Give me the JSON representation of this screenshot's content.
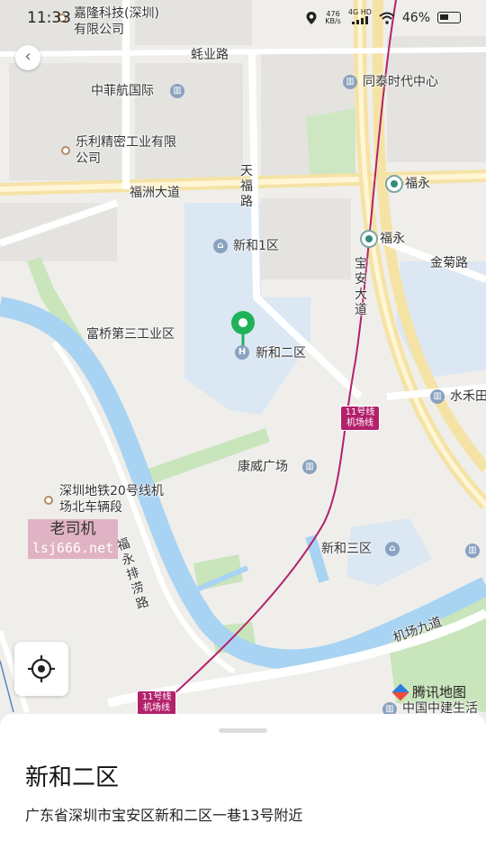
{
  "status_bar": {
    "time": "11:33",
    "net_speed": "476",
    "net_unit": "KB/s",
    "network": "4G HD",
    "battery": "46%"
  },
  "map": {
    "labels": {
      "jialong": "嘉隆科技(深圳)有限公司",
      "haoye_road": "蚝业路",
      "zhongfei": "中菲航国际",
      "tongtai": "同泰时代中心",
      "leli": "乐利精密工业有限公司",
      "fuzhou_ave": "福洲大道",
      "tianfu_road": "天福路",
      "fuyong_a": "福永",
      "fuyong_b": "福永",
      "xinhe1": "新和1区",
      "jinju_road": "金菊路",
      "baoan_ave": "宝安大道",
      "fuqiao": "富桥第三工业区",
      "xinhe2": "新和二区",
      "shuihe": "水禾田",
      "kangwei": "康威广场",
      "metro_depot": "深圳地铁20号线机场北车辆段",
      "fuyong_drain": "福永排涝路",
      "xinhe3": "新和三区",
      "airport_9": "机场九道",
      "cscec": "中国中建生活"
    },
    "line11_badge": "11号线机场线",
    "brand": "腾讯地图",
    "watermark_line1": "老司机",
    "watermark_line2": "lsj666.net",
    "colors": {
      "base": "#efeeeb",
      "block": "#e4e3e0",
      "water": "#a9d3f2",
      "green": "#c9e5bb",
      "blue_zone": "#dbe7f3",
      "metro_line": "#b3216b",
      "pin": "#1fb25a"
    }
  },
  "sheet": {
    "title": "新和二区",
    "address": "广东省深圳市宝安区新和二区一巷13号附近"
  }
}
